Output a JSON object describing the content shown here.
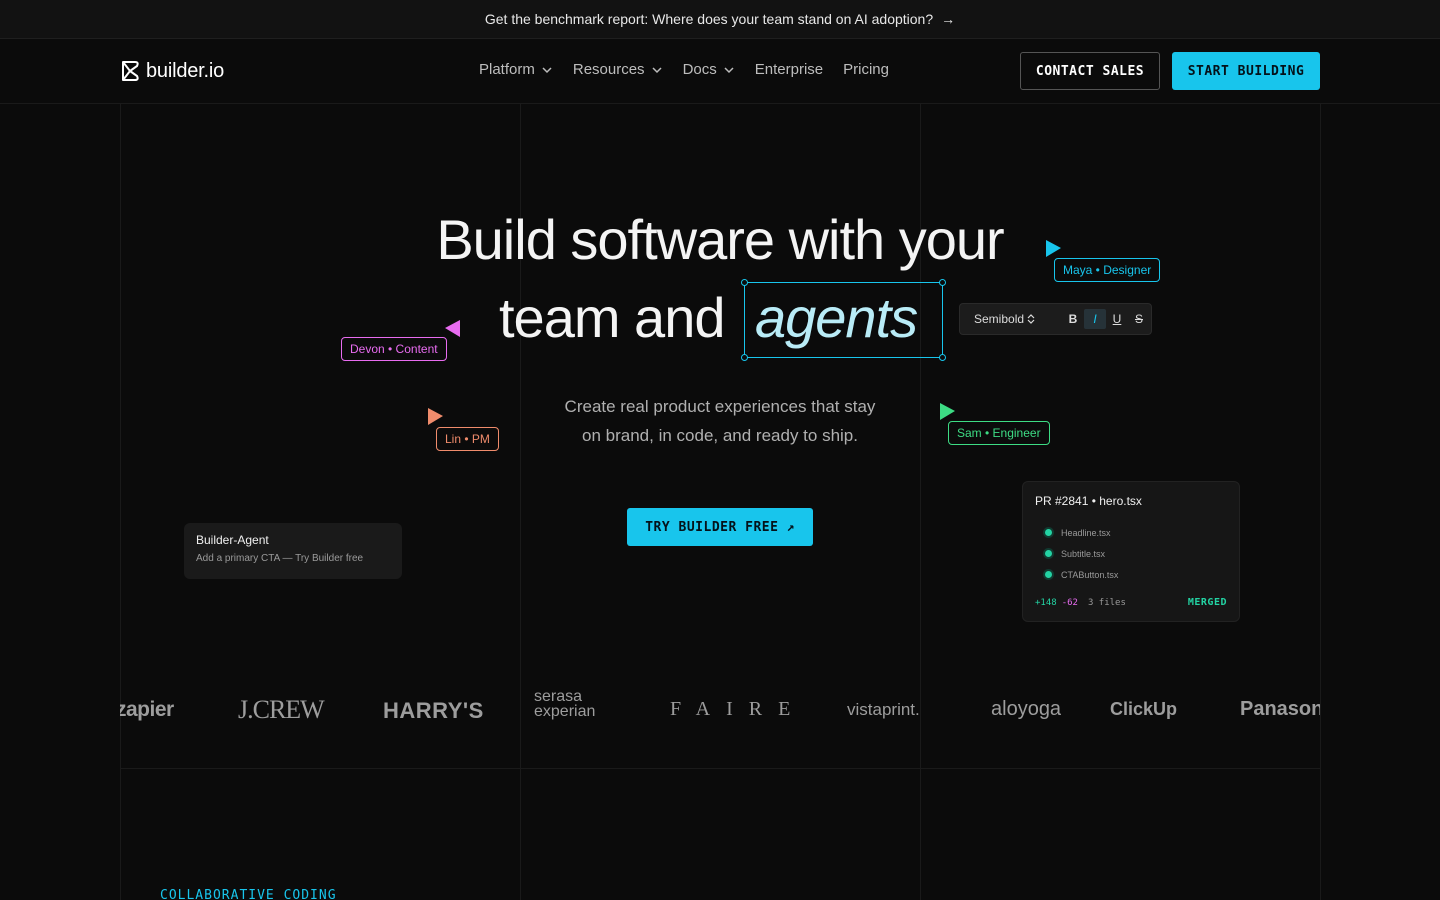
{
  "announcement": {
    "text": "Get the benchmark report: Where does your team stand on AI adoption?",
    "arrow": "→"
  },
  "nav": {
    "brand": "builder.io",
    "menu": [
      {
        "label": "Platform",
        "has_dropdown": true
      },
      {
        "label": "Resources",
        "has_dropdown": true
      },
      {
        "label": "Docs",
        "has_dropdown": true
      },
      {
        "label": "Enterprise",
        "has_dropdown": false
      },
      {
        "label": "Pricing",
        "has_dropdown": false
      }
    ],
    "contact_label": "CONTACT SALES",
    "start_label": "START BUILDING"
  },
  "hero": {
    "line1": "Build software with your",
    "line2": "team and",
    "highlight": "agents",
    "subtitle_line1": "Create real product experiences that stay",
    "subtitle_line2": "on brand, in code, and ready to ship.",
    "cta_label": "TRY BUILDER FREE",
    "cta_icon": "↗"
  },
  "toolbar": {
    "font_weight": "Semibold",
    "buttons": [
      "B",
      "I",
      "U",
      "S"
    ],
    "active": "I"
  },
  "collaborators": [
    {
      "label": "Maya • Designer",
      "color": "#18c5ec"
    },
    {
      "label": "Devon • Content",
      "color": "#e86cf0"
    },
    {
      "label": "Lin • PM",
      "color": "#f08c6c"
    },
    {
      "label": "Sam • Engineer",
      "color": "#3ddc84"
    }
  ],
  "agent_card": {
    "title": "Builder-Agent",
    "message": "Add a primary CTA — Try Builder free"
  },
  "pr_card": {
    "title": "PR #2841 • hero.tsx",
    "files": [
      "Headline.tsx",
      "Subtitle.tsx",
      "CTAButton.tsx"
    ],
    "additions": "+148",
    "deletions": "-62",
    "file_count": "3 files",
    "status": "MERGED"
  },
  "logos": [
    "zapier",
    "J.CREW",
    "HARRY'S",
    "serasa experian",
    "FAIRE",
    "vistaprint.",
    "aloyoga",
    "ClickUp",
    "Panasonic"
  ],
  "section": {
    "label": "COLLABORATIVE CODING"
  },
  "colors": {
    "accent": "#18c5ec",
    "background": "#0b0b0b",
    "merged": "#23d3a3"
  }
}
